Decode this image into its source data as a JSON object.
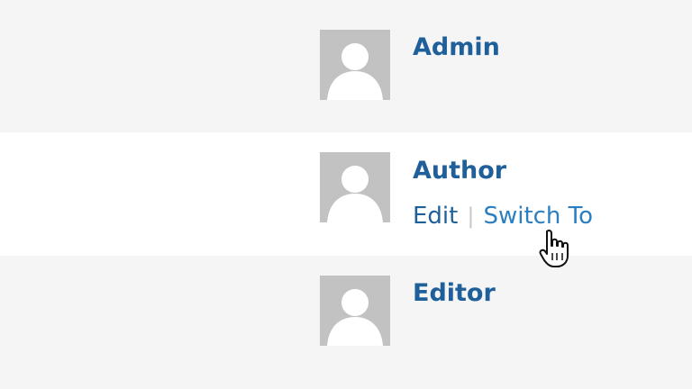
{
  "users": [
    {
      "name": "Admin"
    },
    {
      "name": "Author",
      "actions": {
        "edit": "Edit",
        "separator": "|",
        "switch_to": "Switch To"
      }
    },
    {
      "name": "Editor"
    }
  ],
  "colors": {
    "link": "#1f5f9a",
    "link_hover": "#2b7fc0",
    "avatar": "#c2c2c2",
    "row_bg": "#f5f5f5",
    "row_hover_bg": "#ffffff"
  },
  "cursor_icon": "hand-pointer-icon"
}
